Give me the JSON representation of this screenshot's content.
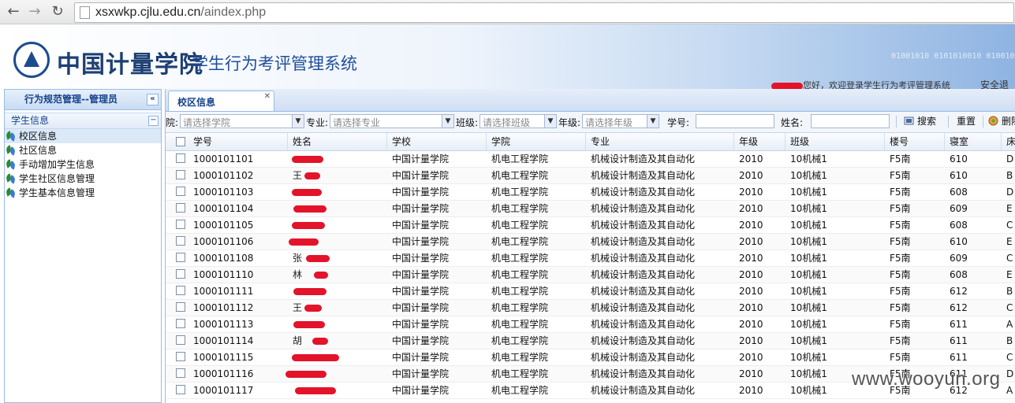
{
  "browser": {
    "url_host": "xsxwkp.cjlu.edu.cn",
    "url_path": "/aindex.php"
  },
  "header": {
    "school_name": "中国计量学院",
    "system_name": "学生行为考评管理系统",
    "binary_text": "01001010 0101010010 010010",
    "welcome_text": "您好，欢迎登录学生行为考评管理系统",
    "logout_label": "安全退"
  },
  "left_panel": {
    "title": "行为规范管理--管理员",
    "section": "学生信息",
    "items": [
      {
        "label": "校区信息",
        "active": true
      },
      {
        "label": "社区信息",
        "active": false
      },
      {
        "label": "手动增加学生信息",
        "active": false
      },
      {
        "label": "学生社区信息管理",
        "active": false
      },
      {
        "label": "学生基本信息管理",
        "active": false
      }
    ]
  },
  "tabs": [
    {
      "label": "校区信息"
    }
  ],
  "toolbar": {
    "college_label": "院:",
    "college_placeholder": "请选择学院",
    "major_label": "专业:",
    "major_placeholder": "请选择专业",
    "class_label": "班级:",
    "class_placeholder": "请选择班级",
    "grade_label": "年级:",
    "grade_placeholder": "请选择年级",
    "student_id_label": "学号:",
    "name_label": "姓名:",
    "search_label": "搜索",
    "reset_label": "重置",
    "delete_label": "删除"
  },
  "grid": {
    "columns": [
      "学号",
      "姓名",
      "学校",
      "学院",
      "专业",
      "年级",
      "班级",
      "楼号",
      "寝室",
      "床"
    ],
    "rows": [
      {
        "id": "1000101101",
        "name": "",
        "school": "中国计量学院",
        "college": "机电工程学院",
        "major": "机械设计制造及其自动化",
        "grade": "2010",
        "class": "10机械1",
        "building": "F5南",
        "room": "610",
        "bed": "D"
      },
      {
        "id": "1000101102",
        "name": "王",
        "school": "中国计量学院",
        "college": "机电工程学院",
        "major": "机械设计制造及其自动化",
        "grade": "2010",
        "class": "10机械1",
        "building": "F5南",
        "room": "610",
        "bed": "B"
      },
      {
        "id": "1000101103",
        "name": "",
        "school": "中国计量学院",
        "college": "机电工程学院",
        "major": "机械设计制造及其自动化",
        "grade": "2010",
        "class": "10机械1",
        "building": "F5南",
        "room": "608",
        "bed": "D"
      },
      {
        "id": "1000101104",
        "name": "",
        "school": "中国计量学院",
        "college": "机电工程学院",
        "major": "机械设计制造及其自动化",
        "grade": "2010",
        "class": "10机械1",
        "building": "F5南",
        "room": "609",
        "bed": "E"
      },
      {
        "id": "1000101105",
        "name": "",
        "school": "中国计量学院",
        "college": "机电工程学院",
        "major": "机械设计制造及其自动化",
        "grade": "2010",
        "class": "10机械1",
        "building": "F5南",
        "room": "608",
        "bed": "C"
      },
      {
        "id": "1000101106",
        "name": "",
        "school": "中国计量学院",
        "college": "机电工程学院",
        "major": "机械设计制造及其自动化",
        "grade": "2010",
        "class": "10机械1",
        "building": "F5南",
        "room": "610",
        "bed": "E"
      },
      {
        "id": "1000101108",
        "name": "张",
        "school": "中国计量学院",
        "college": "机电工程学院",
        "major": "机械设计制造及其自动化",
        "grade": "2010",
        "class": "10机械1",
        "building": "F5南",
        "room": "609",
        "bed": "C"
      },
      {
        "id": "1000101110",
        "name": "林",
        "school": "中国计量学院",
        "college": "机电工程学院",
        "major": "机械设计制造及其自动化",
        "grade": "2010",
        "class": "10机械1",
        "building": "F5南",
        "room": "608",
        "bed": "E"
      },
      {
        "id": "1000101111",
        "name": "",
        "school": "中国计量学院",
        "college": "机电工程学院",
        "major": "机械设计制造及其自动化",
        "grade": "2010",
        "class": "10机械1",
        "building": "F5南",
        "room": "612",
        "bed": "B"
      },
      {
        "id": "1000101112",
        "name": "王",
        "school": "中国计量学院",
        "college": "机电工程学院",
        "major": "机械设计制造及其自动化",
        "grade": "2010",
        "class": "10机械1",
        "building": "F5南",
        "room": "612",
        "bed": "C"
      },
      {
        "id": "1000101113",
        "name": "",
        "school": "中国计量学院",
        "college": "机电工程学院",
        "major": "机械设计制造及其自动化",
        "grade": "2010",
        "class": "10机械1",
        "building": "F5南",
        "room": "611",
        "bed": "A"
      },
      {
        "id": "1000101114",
        "name": "胡",
        "school": "中国计量学院",
        "college": "机电工程学院",
        "major": "机械设计制造及其自动化",
        "grade": "2010",
        "class": "10机械1",
        "building": "F5南",
        "room": "611",
        "bed": "B"
      },
      {
        "id": "1000101115",
        "name": "",
        "school": "中国计量学院",
        "college": "机电工程学院",
        "major": "机械设计制造及其自动化",
        "grade": "2010",
        "class": "10机械1",
        "building": "F5南",
        "room": "611",
        "bed": "C"
      },
      {
        "id": "1000101116",
        "name": "",
        "school": "中国计量学院",
        "college": "机电工程学院",
        "major": "机械设计制造及其自动化",
        "grade": "2010",
        "class": "10机械1",
        "building": "F5南",
        "room": "611",
        "bed": "D"
      },
      {
        "id": "1000101117",
        "name": "",
        "school": "中国计量学院",
        "college": "机电工程学院",
        "major": "机械设计制造及其自动化",
        "grade": "2010",
        "class": "10机械1",
        "building": "F5南",
        "room": "612",
        "bed": "A"
      }
    ]
  },
  "watermark": "www.wooyun.org",
  "colors": {
    "accent": "#15428b",
    "redaction": "#e3132a",
    "panel_border": "#99bbe8"
  }
}
